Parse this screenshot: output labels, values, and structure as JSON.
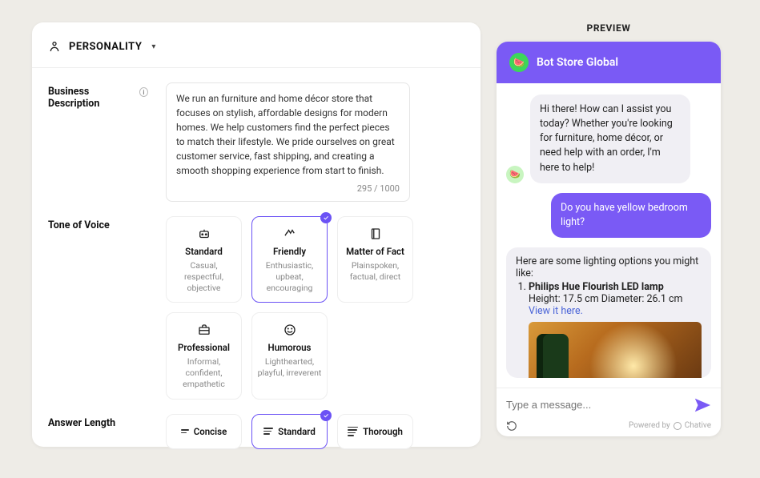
{
  "section": {
    "title": "PERSONALITY"
  },
  "desc": {
    "label": "Business Description",
    "text": "We run an furniture and home décor store that focuses on stylish, affordable designs for modern homes. We help customers find the perfect pieces to match their lifestyle. We pride ourselves on great customer service, fast shipping, and creating a smooth shopping experience from start to finish.",
    "counter": "295 / 1000"
  },
  "tone": {
    "label": "Tone of Voice",
    "options": [
      {
        "title": "Standard",
        "sub": "Casual, respectful, objective",
        "selected": false,
        "icon": "robot"
      },
      {
        "title": "Friendly",
        "sub": "Enthusiastic, upbeat, encouraging",
        "selected": true,
        "icon": "wave"
      },
      {
        "title": "Matter of Fact",
        "sub": "Plainspoken, factual, direct",
        "selected": false,
        "icon": "book"
      },
      {
        "title": "Professional",
        "sub": "Informal, confident, empathetic",
        "selected": false,
        "icon": "briefcase"
      },
      {
        "title": "Humorous",
        "sub": "Lighthearted, playful, irreverent",
        "selected": false,
        "icon": "smile"
      }
    ]
  },
  "length": {
    "label": "Answer Length",
    "options": [
      {
        "title": "Concise",
        "selected": false,
        "bars": 2
      },
      {
        "title": "Standard",
        "selected": true,
        "bars": 3
      },
      {
        "title": "Thorough",
        "selected": false,
        "bars": 4
      }
    ]
  },
  "preview": {
    "title": "PREVIEW",
    "botName": "Bot Store Global",
    "msg1": "Hi there! How can I assist you today? Whether you're looking for furniture, home décor, or need help with an order, I'm here to help!",
    "msg2": "Do you have yellow bedroom light?",
    "msg3_intro": "Here are some lighting options you might like:",
    "product_name": "Philips Hue Flourish LED lamp",
    "product_dims": "Height: 17.5 cm Diameter: 26.1 cm",
    "product_link": "View it here",
    "placeholder": "Type a message...",
    "powered": "Powered by",
    "brand": "Chative"
  }
}
